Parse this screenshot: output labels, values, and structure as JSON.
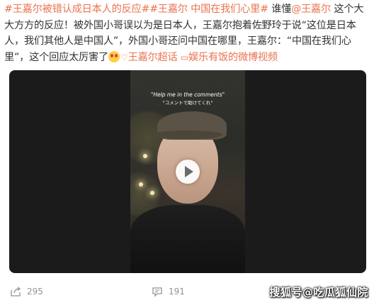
{
  "post": {
    "tag1": "#王嘉尔被错认成日本人的反应#",
    "tag2": "#王嘉尔 中国在我们心里#",
    "text_part1": " 谁懂",
    "mention": "@王嘉尔",
    "text_part2": " 这个大大方方的反应！被外国小哥误以为是日本人，王嘉尔抱着佐野玲于说“这位是日本人，我们其他人是中国人”，外国小哥还问中国在哪里，王嘉尔：“中国在我们心里”，这个回应太厉害了",
    "super_topic_label": "王嘉尔超话",
    "video_source_label": "娱乐有饭的微博视频"
  },
  "video": {
    "caption_en": "\"Help me in the comments\"",
    "caption_jp": "\"コメントで助けてくれ\""
  },
  "actions": {
    "share_count": "295",
    "comment_count": "191"
  },
  "watermark": "搜狐号@吃瓜狐仙院",
  "colors": {
    "accent": "#eb7350",
    "text": "#333333",
    "muted": "#939393"
  }
}
